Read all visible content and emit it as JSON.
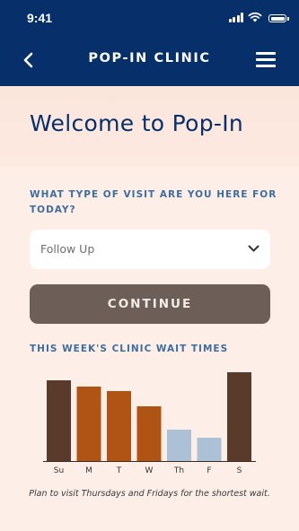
{
  "status_bar": {
    "time": "9:41"
  },
  "nav": {
    "title": "POP-IN CLINIC"
  },
  "welcome": {
    "title": "Welcome to Pop-In"
  },
  "visit_type": {
    "question": "WHAT TYPE OF VISIT ARE YOU HERE FOR TODAY?",
    "selected": "Follow Up"
  },
  "continue_label": "CONTINUE",
  "wait_times": {
    "title": "THIS WEEK'S CLINIC WAIT TIMES",
    "note": "Plan to visit Thursdays and Fridays for the shortest wait."
  },
  "colors": {
    "header": "#07306a",
    "accent_text": "#3f6e9c",
    "button": "#6d5f58",
    "bar_dark": "#5a3a2a",
    "bar_orange": "#b05416",
    "bar_light": "#adc1d6"
  },
  "chart_data": {
    "type": "bar",
    "categories": [
      "Su",
      "M",
      "T",
      "W",
      "Th",
      "F",
      "S"
    ],
    "values": [
      90,
      83,
      78,
      61,
      35,
      26,
      99
    ],
    "ylim": [
      0,
      100
    ],
    "bar_colors": [
      "#5a3a2a",
      "#b05416",
      "#b05416",
      "#b05416",
      "#adc1d6",
      "#adc1d6",
      "#5a3a2a"
    ],
    "title": "THIS WEEK'S CLINIC WAIT TIMES",
    "xlabel": "",
    "ylabel": "",
    "grid": false
  }
}
